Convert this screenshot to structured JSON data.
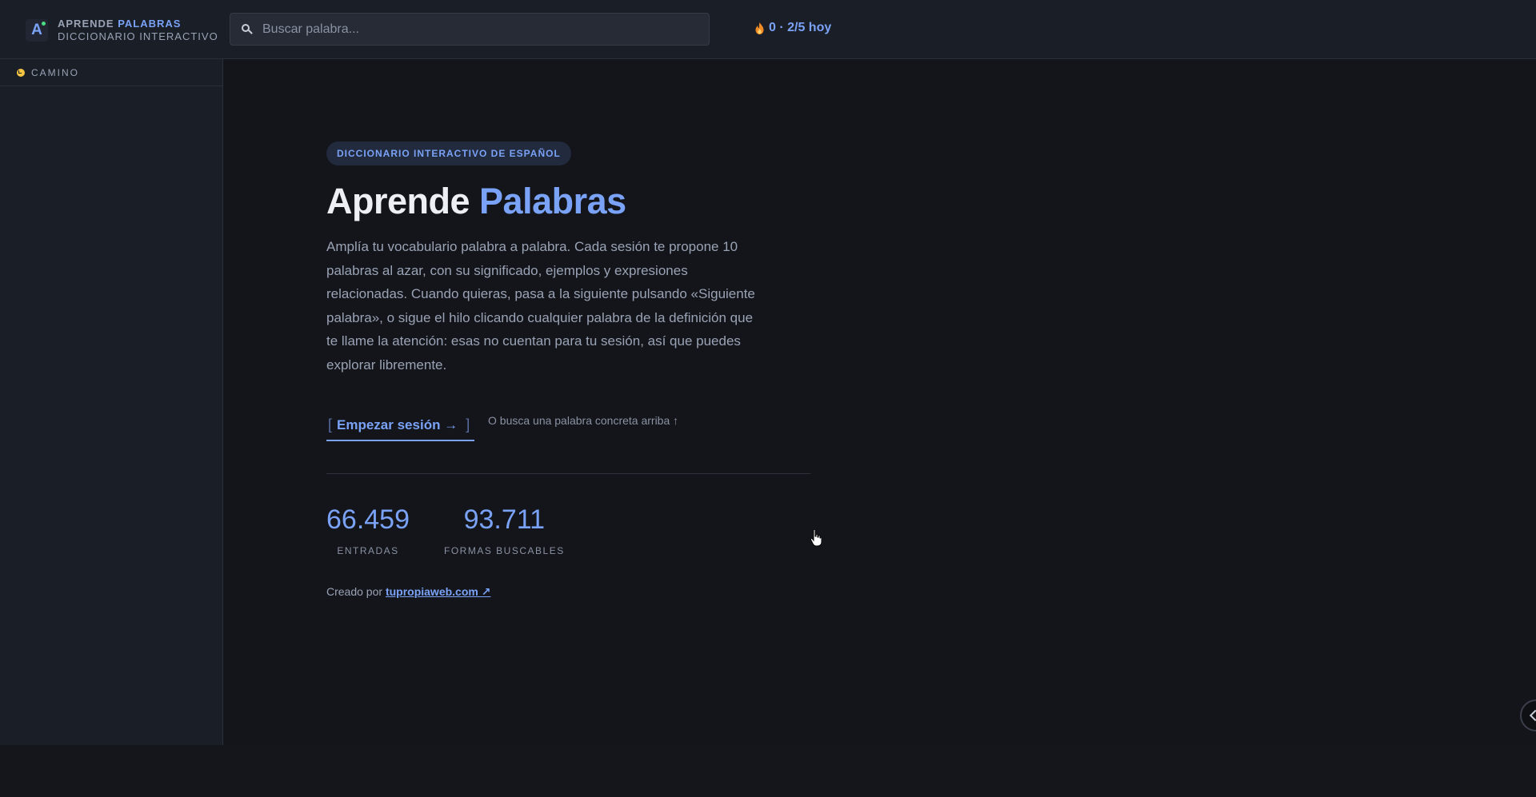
{
  "header": {
    "brand_line1_a": "APRENDE",
    "brand_line1_b": "PALABRAS",
    "brand_line2": "DICCIONARIO INTERACTIVO",
    "logo_letter": "A",
    "search_placeholder": "Buscar palabra...",
    "streak": "0 · 2/5 hoy"
  },
  "sidebar": {
    "heading": "CAMINO"
  },
  "main": {
    "tag": "DICCIONARIO INTERACTIVO DE ESPAÑOL",
    "title_a": "Aprende",
    "title_b": "Palabras",
    "description": "Amplía tu vocabulario palabra a palabra. Cada sesión te propone 10 palabras al azar, con su significado, ejemplos y expresiones relacionadas. Cuando quieras, pasa a la siguiente pulsando «Siguiente palabra», o sigue el hilo clicando cualquier palabra de la definición que te llame la atención: esas no cuentan para tu sesión, así que puedes explorar libremente.",
    "cta_open": "[",
    "cta_label": "Empezar sesión →",
    "cta_close": "]",
    "hint": "O busca una palabra concreta arriba ↑",
    "stats": [
      {
        "value": "66.459",
        "label": "ENTRADAS"
      },
      {
        "value": "93.711",
        "label": "FORMAS BUSCABLES"
      }
    ],
    "credit_prefix": "Creado por",
    "credit_link": "tupropiaweb.com ↗"
  },
  "colors": {
    "accent": "#7aa2f7",
    "background": "#13151a",
    "panel": "#1a1e27"
  },
  "icons": {
    "search": "search-icon",
    "streak": "flame-icon",
    "sidebar": "compass-icon",
    "toggle": "chevron-left-icon"
  }
}
